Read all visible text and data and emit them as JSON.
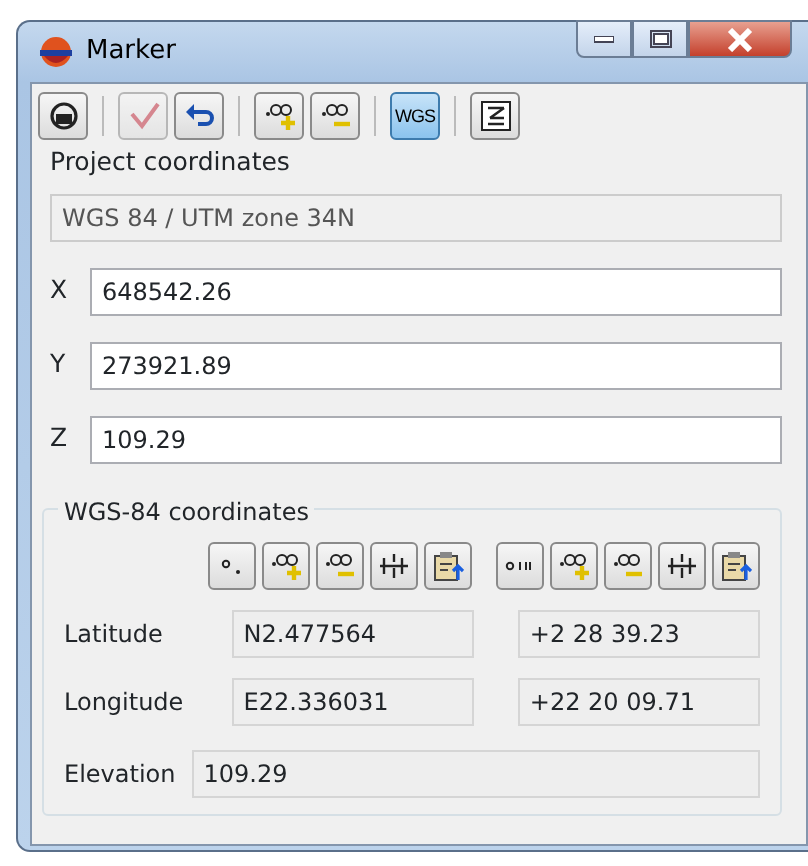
{
  "window": {
    "title": "Marker"
  },
  "toolbar": [
    {
      "kind": "lock",
      "disabled": false,
      "pressed": false
    },
    {
      "kind": "sep"
    },
    {
      "kind": "check",
      "disabled": true,
      "pressed": false
    },
    {
      "kind": "undo",
      "disabled": false,
      "pressed": false
    },
    {
      "kind": "sep"
    },
    {
      "kind": "plus",
      "disabled": false,
      "pressed": false
    },
    {
      "kind": "minus",
      "disabled": false,
      "pressed": false
    },
    {
      "kind": "sep"
    },
    {
      "kind": "text",
      "label": "WGS",
      "disabled": false,
      "pressed": true
    },
    {
      "kind": "sep"
    },
    {
      "kind": "sigma",
      "disabled": false,
      "pressed": false
    }
  ],
  "project": {
    "title": "Project coordinates",
    "projection": "WGS 84 / UTM zone 34N",
    "fields": [
      {
        "label": "X",
        "value": "648542.26"
      },
      {
        "label": "Y",
        "value": "273921.89"
      },
      {
        "label": "Z",
        "value": "109.29"
      }
    ]
  },
  "wgs": {
    "title": "WGS-84 coordinates",
    "tool_groups": [
      {
        "buttons": [
          {
            "kind": "deg"
          },
          {
            "kind": "plus"
          },
          {
            "kind": "minus"
          },
          {
            "kind": "nse"
          },
          {
            "kind": "paste"
          }
        ]
      },
      {
        "buttons": [
          {
            "kind": "dms"
          },
          {
            "kind": "plus"
          },
          {
            "kind": "minus"
          },
          {
            "kind": "nse"
          },
          {
            "kind": "paste"
          }
        ]
      }
    ],
    "rows": [
      {
        "label": "Latitude",
        "decimal": "N2.477564",
        "dms": "+2 28 39.23"
      },
      {
        "label": "Longitude",
        "decimal": "E22.336031",
        "dms": "+22 20 09.71"
      }
    ],
    "elevation": {
      "label": "Elevation",
      "value": "109.29"
    }
  }
}
